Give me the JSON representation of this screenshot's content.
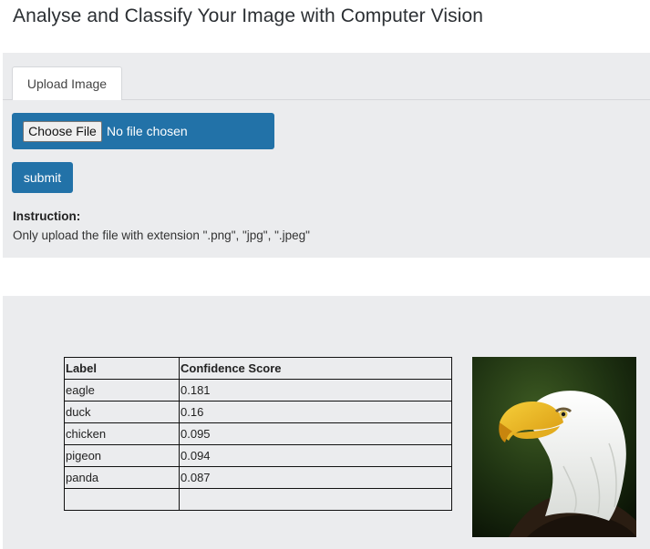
{
  "page": {
    "title": "Analyse and Classify Your Image with Computer Vision"
  },
  "upload": {
    "tab_label": "Upload Image",
    "choose_file_label": "Choose File",
    "file_status": "No file chosen",
    "submit_label": "submit",
    "instruction_heading": "Instruction:",
    "instruction_text": "Only upload the file with extension \".png\", \"jpg\", \".jpeg\""
  },
  "results": {
    "headers": [
      "Label",
      "Confidence Score"
    ],
    "rows": [
      {
        "label": "eagle",
        "score": "0.181"
      },
      {
        "label": "duck",
        "score": "0.16"
      },
      {
        "label": "chicken",
        "score": "0.095"
      },
      {
        "label": "pigeon",
        "score": "0.094"
      },
      {
        "label": "panda",
        "score": "0.087"
      }
    ],
    "image_subject": "bald-eagle"
  },
  "colors": {
    "accent": "#2272a8",
    "panel_background": "#ebecee"
  }
}
